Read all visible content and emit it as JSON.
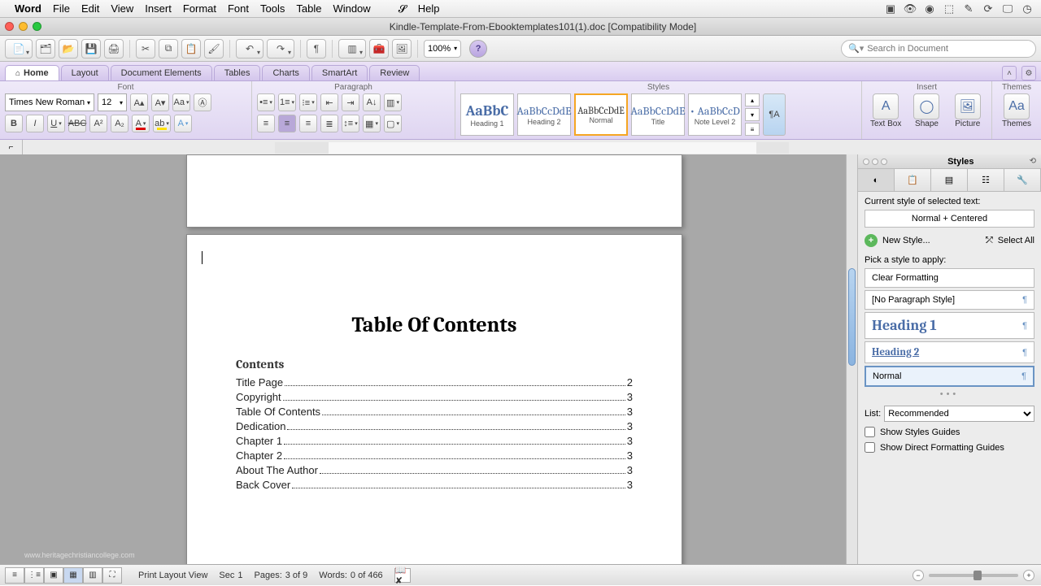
{
  "menubar": {
    "app": "Word",
    "items": [
      "File",
      "Edit",
      "View",
      "Insert",
      "Format",
      "Font",
      "Tools",
      "Table",
      "Window",
      "Help"
    ]
  },
  "window": {
    "title": "Kindle-Template-From-Ebooktemplates101(1).doc [Compatibility Mode]"
  },
  "toolbar": {
    "zoom": "100%",
    "search_placeholder": "Search in Document"
  },
  "ribbon": {
    "tabs": [
      "Home",
      "Layout",
      "Document Elements",
      "Tables",
      "Charts",
      "SmartArt",
      "Review"
    ],
    "groups": {
      "font": "Font",
      "paragraph": "Paragraph",
      "styles": "Styles",
      "insert": "Insert",
      "themes": "Themes"
    },
    "font_name": "Times New Roman",
    "font_size": "12",
    "style_items": [
      {
        "name": "Heading 1",
        "preview": "AaBbC"
      },
      {
        "name": "Heading 2",
        "preview": "AaBbCcDdE"
      },
      {
        "name": "Normal",
        "preview": "AaBbCcDdE"
      },
      {
        "name": "Title",
        "preview": "AaBbCcDdE"
      },
      {
        "name": "Note Level 2",
        "preview": "• AaBbCcD"
      }
    ],
    "insert_items": [
      "Text Box",
      "Shape",
      "Picture"
    ],
    "themes_label": "Themes"
  },
  "document": {
    "title": "Table Of Contents",
    "contents_label": "Contents",
    "toc": [
      {
        "label": "Title Page",
        "page": "2"
      },
      {
        "label": "Copyright",
        "page": "3"
      },
      {
        "label": "Table Of Contents",
        "page": "3"
      },
      {
        "label": "Dedication",
        "page": "3"
      },
      {
        "label": "Chapter 1",
        "page": "3"
      },
      {
        "label": "Chapter 2",
        "page": "3"
      },
      {
        "label": "About The Author",
        "page": "3"
      },
      {
        "label": "Back Cover",
        "page": "3"
      }
    ]
  },
  "styles_panel": {
    "title": "Styles",
    "current_label": "Current style of selected text:",
    "current_value": "Normal + Centered",
    "new_style": "New Style...",
    "select_all": "Select All",
    "pick_label": "Pick a style to apply:",
    "list": [
      {
        "name": "Clear Formatting",
        "para": false
      },
      {
        "name": "[No Paragraph Style]",
        "para": true
      },
      {
        "name": "Heading 1",
        "para": true,
        "cls": "h1"
      },
      {
        "name": "Heading 2",
        "para": true,
        "cls": "h2"
      },
      {
        "name": "Normal",
        "para": true,
        "sel": true
      }
    ],
    "list_label": "List:",
    "list_value": "Recommended",
    "guides1": "Show Styles Guides",
    "guides2": "Show Direct Formatting Guides"
  },
  "statusbar": {
    "view": "Print Layout View",
    "sec_label": "Sec",
    "sec": "1",
    "pages_label": "Pages:",
    "pages": "3 of 9",
    "words_label": "Words:",
    "words": "0 of 466"
  },
  "watermark": "www.heritagechristiancollege.com"
}
